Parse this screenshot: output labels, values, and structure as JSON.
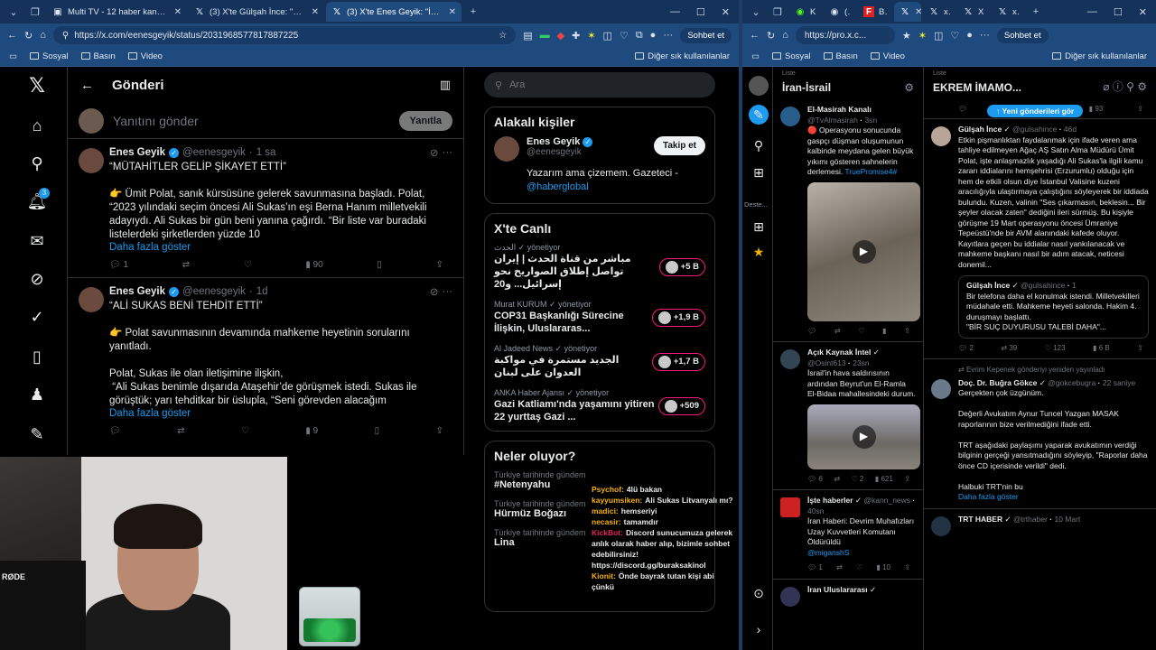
{
  "w1": {
    "tabs": [
      {
        "icon": "tv-icon",
        "title": "Multi TV - 12 haber kanalını aynı a"
      },
      {
        "icon": "x-icon",
        "title": "(3) X'te Gülşah İnce: \"Etkin pişman"
      },
      {
        "icon": "x-icon",
        "title": "(3) X'te Enes Geyik: \"İBB DAVASINI"
      }
    ],
    "url": "https://x.com/eenesgeyik/status/2031968577817887225",
    "sohbet": "Sohbet et",
    "bookmarks": [
      "Sosyal",
      "Basın",
      "Video"
    ],
    "bookmarks_right": "Diğer sık kullanılanlar",
    "nav_badge": "3",
    "page_title": "Gönderi",
    "reply_placeholder": "Yanıtını gönder",
    "reply_button": "Yanıtla",
    "tweets": [
      {
        "name": "Enes Geyik",
        "handle": "@eenesgeyik",
        "time": "1 sa",
        "body": "“MÜTAHİTLER GELİP ŞİKAYET ETTİ”\n\n👉 Ümit Polat, sanık kürsüsüne gelerek savunmasına başladı. Polat, “2023 yılındaki seçim öncesi Ali Sukas’ın eşi Berna Hanım milletvekili adayıydı. Ali Sukas bir gün beni yanına çağırdı. “Bir liste var buradaki listelerdeki şirketlerden yüzde 10",
        "more": "Daha fazla göster",
        "replies": "1",
        "reposts": "",
        "likes": "",
        "views": "90"
      },
      {
        "name": "Enes Geyik",
        "handle": "@eenesgeyik",
        "time": "1d",
        "body": "“ALİ SUKAS BENİ TEHDİT ETTİ”\n\n👉 Polat savunmasının devamında mahkeme heyetinin sorularını yanıtladı.\n\nPolat, Sukas ile olan iletişimine ilişkin,\n “Ali Sukas benimle dışarıda Ataşehir’de görüşmek istedi. Sukas ile görüştük; yarı tehditkar bir üslupla, “Seni görevden alacağım",
        "more": "Daha fazla göster",
        "replies": "",
        "reposts": "",
        "likes": "",
        "views": "9"
      }
    ],
    "search_placeholder": "Ara",
    "related_title": "Alakalı kişiler",
    "related": {
      "name": "Enes Geyik",
      "handle": "@eenesgeyik",
      "bio": "Yazarım ama çizemem. Gazeteci - ",
      "bio_link": "@haberglobal",
      "follow": "Takip et"
    },
    "live_title": "X'te Canlı",
    "live": [
      {
        "host": "الحدث",
        "role": "yönetiyor",
        "title": "مباشر من قناة الحدث | إيران تواصل إطلاق الصواريخ نحو إسرائيل... و20",
        "count": "+5 B"
      },
      {
        "host": "Murat KURUM",
        "role": "yönetiyor",
        "title": "COP31 Başkanlığı Sürecine İlişkin, Uluslararas...",
        "count": "+1,9 B"
      },
      {
        "host": "Al Jadeed News",
        "role": "yönetiyor",
        "title": "الجديد مستمرة في مواكبة العدوان على لبنان",
        "count": "+1,7 B"
      },
      {
        "host": "ANKA Haber Ajansı",
        "role": "yönetiyor",
        "title": "Gazi Katliamı'nda yaşamını yitiren 22 yurttaş Gazi ...",
        "count": "+509"
      }
    ],
    "trends_title": "Neler oluyor?",
    "trends": [
      {
        "meta": "Türkiye tarihinde gündem",
        "topic": "#Netenyahu"
      },
      {
        "meta": "Türkiye tarihinde gündem",
        "topic": "Hürmüz Boğazı"
      },
      {
        "meta": "Türkiye tarihinde gündem",
        "topic": "Lina"
      }
    ],
    "chat": [
      {
        "user": "Psychof:",
        "msg": "4lü bakan",
        "color": "#f5b301"
      },
      {
        "user": "kayyumsiken:",
        "msg": "Ali Sukas Litvanyalı mı?",
        "color": "#f5b301"
      },
      {
        "user": "madici:",
        "msg": "hemseriyi",
        "color": "#f5b301"
      },
      {
        "user": "necasir:",
        "msg": "tamamdır",
        "color": "#f5b301"
      },
      {
        "user": "KickBot:",
        "msg": "Discord sunucumuza gelerek anlık olarak haber alıp, bizimle sohbet edebilirsiniz! https://discord.gg/buraksakinol",
        "color": "#e0245e"
      },
      {
        "user": "Kionit:",
        "msg": "Önde bayrak tutan kişi abi çünkü",
        "color": "#f5b301"
      }
    ],
    "mic_brand": "RØDE"
  },
  "w2": {
    "tabs": [
      "Kick",
      "(3) A",
      "BRE",
      "",
      "x.co",
      "X'te",
      "x.co"
    ],
    "url": "https://pro.x.c...",
    "sohbet": "Sohbet et",
    "bookmarks": [
      "Sosyal",
      "Basın",
      "Video"
    ],
    "bookmarks_right": "Diğer sık kullanılanlar",
    "desteklenen": "Deste...",
    "col1": {
      "label": "Liste",
      "title": "İran-İsrail",
      "posts": [
        {
          "name": "El-Masirah Kanalı",
          "handle": "@TvAlmasirah",
          "time": "3sn",
          "body": "🔴 Operasyonu sonucunda gaspçı düşman oluşumunun kalbinde meydana gelen büyük yıkımı gösteren sahnelerin derlemesi. ",
          "tag": "TruePromise4#",
          "stats": [
            "",
            "",
            "",
            "",
            ""
          ]
        },
        {
          "name": "Açık Kaynak İntel",
          "handle": "@Osint613",
          "time": "23sn",
          "body": "İsrail'in hava saldırısının ardından Beyrut'un El-Ramla El-Bidaa mahallesindeki durum.",
          "stats": [
            "6",
            "",
            "2",
            "621",
            ""
          ]
        },
        {
          "name": "İşte haberler",
          "handle": "@kann_news",
          "time": "40sn",
          "body": "İran Haberi: Devrim Muhafızları Uzay Kuvvetleri Komutanı Öldürüldü",
          "tag": "@miganshS",
          "stats": [
            "1",
            "",
            "",
            "10",
            ""
          ]
        },
        {
          "name": "İran Uluslararası",
          "handle": "",
          "time": "",
          "body": "",
          "stats": []
        }
      ]
    },
    "col2": {
      "label": "Liste",
      "title": "EKREM İMAMO...",
      "new_posts": "Yeni gönderileri gör",
      "top_stats": [
        "",
        "1",
        "",
        "93",
        ""
      ],
      "posts": [
        {
          "name": "Gülşah İnce",
          "handle": "@gulsahince",
          "time": "46d",
          "body": "Etkin pişmanlıktan faydalanmak için ifade veren ama tahliye edilmeyen Ağaç AŞ Satın Alma Müdürü Ümit Polat, işte anlaşmazlık yaşadığı Ali Sukas'la ilgili kamu zararı iddialarını hemşehrisi (Erzurumlu) olduğu için hem de etkili olsun diye İstanbul Valisine kuzeni aracılığıyla ulaştırmaya çalıştığını söyleyerek bir iddiada bulundu. Kuzen, valinin \"Ses çıkarmasın, beklesin... Bir şeyler olacak zaten\" dediğini ileri sürmüş. Bu kişiyle görüşme 19 Mart operasyonu öncesi Ümraniye Tepeüstü'nde bir AVM alanındaki kafede oluyor. Kayıtlara geçen bu iddialar nasıl yankılanacak ve mahkeme başkanı nasıl bir adım atacak, neticesi donemil...",
          "quote": {
            "name": "Gülşah İnce",
            "handle": "@gulsahince",
            "time": "1",
            "body": "Bir telefona daha el konulmak istendi. Milletvekilleri müdahale etti. Mahkeme heyeti salonda. Hakim 4. duruşmayı başlattı.\n\"BİR SUÇ DUYURUSU TALEBİ DAHA\"..."
          },
          "stats": [
            "2",
            "39",
            "123",
            "6 B",
            ""
          ]
        },
        {
          "reposted": "Evrim Kepenek gönderiyi yeniden yayınladı",
          "name": "Doç. Dr. Buğra Gökce",
          "handle": "@gokcebugra",
          "time": "22 saniye",
          "body": "Gerçekten çok üzgünüm.\n\nDeğerli Avukatım Aynur Tuncel Yazgan MASAK raporlarının bize verilmediğini ifade etti.\n\nTRT aşağıdaki paylaşımı yaparak avukatımın verdiği bilginin gerçeği yansıtmadığını söyleyip, \"Raporlar daha önce CD içerisinde verildi\" dedi.\n\nHalbuki TRT'nin bu",
          "more": "Daha fazla göster"
        },
        {
          "name": "TRT HABER",
          "handle": "@trthaber",
          "time": "10 Mart",
          "body": ""
        }
      ]
    }
  }
}
